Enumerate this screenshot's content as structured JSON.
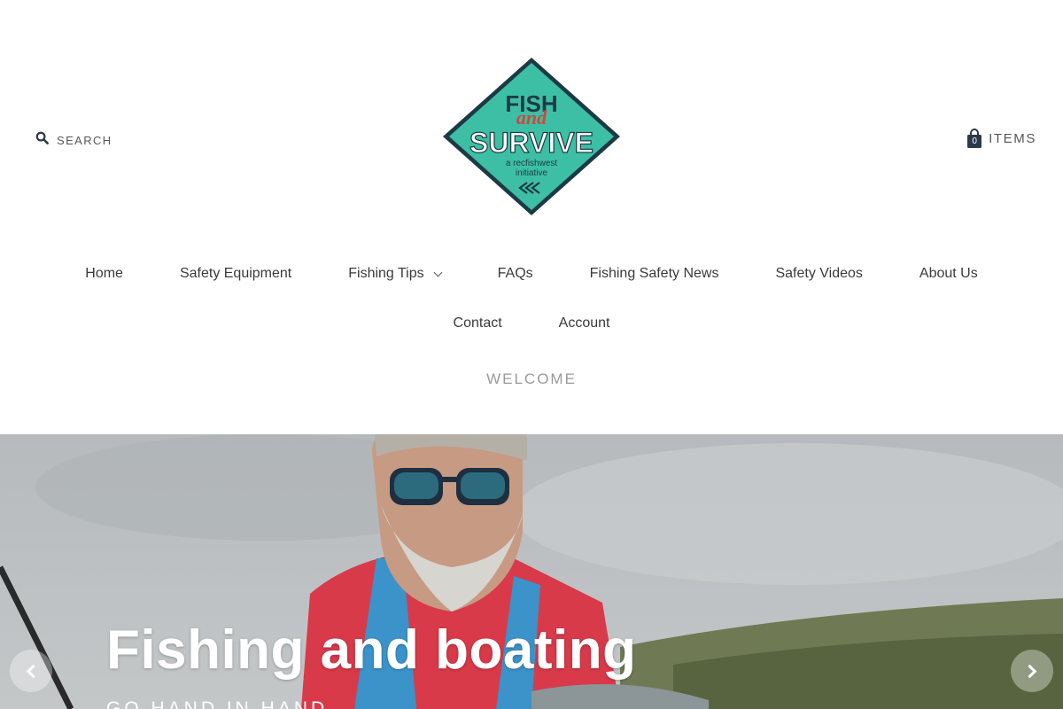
{
  "header": {
    "search_label": "SEARCH",
    "cart": {
      "count": "0",
      "label": "ITEMS"
    },
    "logo": {
      "line1": "FISH",
      "line2": "and",
      "line3": "SURVIVE",
      "tagline1": "a recfishwest",
      "tagline2": "initiative"
    }
  },
  "nav": {
    "row1": [
      "Home",
      "Safety Equipment",
      "Fishing Tips",
      "FAQs",
      "Fishing Safety News",
      "Safety Videos",
      "About Us"
    ],
    "row2": [
      "Contact",
      "Account"
    ],
    "welcome": "WELCOME"
  },
  "hero": {
    "title": "Fishing and boating",
    "subtitle": "GO HAND IN HAND"
  },
  "colors": {
    "logo_teal": "#3dbfa6",
    "logo_dark": "#1d3a44",
    "logo_red": "#c94a3c"
  },
  "icons": {
    "search": "search-icon",
    "cart": "shopping-bag-icon",
    "dropdown": "chevron-down-icon",
    "prev": "chevron-left-icon",
    "next": "chevron-right-icon"
  }
}
